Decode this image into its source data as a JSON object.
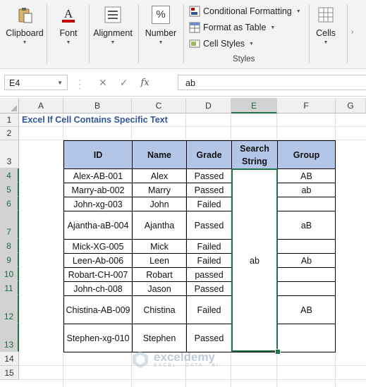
{
  "ribbon": {
    "clipboard": "Clipboard",
    "font": "Font",
    "alignment": "Alignment",
    "number": "Number",
    "number_icon": "%",
    "conditional_formatting": "Conditional Formatting",
    "format_as_table": "Format as Table",
    "cell_styles": "Cell Styles",
    "styles_group": "Styles",
    "cells": "Cells"
  },
  "formula_bar": {
    "name_box": "E4",
    "fx": "fx",
    "content": "ab"
  },
  "columns": [
    "A",
    "B",
    "C",
    "D",
    "E",
    "F",
    "G"
  ],
  "rows": [
    "1",
    "2",
    "3",
    "4",
    "5",
    "6",
    "7",
    "8",
    "9",
    "10",
    "11",
    "12",
    "13",
    "14",
    "15"
  ],
  "sheet": {
    "title": "Excel If Cell Contains Specific Text",
    "headers": [
      "ID",
      "Name",
      "Grade",
      "Search String",
      "Group"
    ],
    "search_string": "ab",
    "table": [
      {
        "id": "Alex-AB-001",
        "name": "Alex",
        "grade": "Passed",
        "group": "AB"
      },
      {
        "id": "Marry-ab-002",
        "name": "Marry",
        "grade": "Passed",
        "group": "ab"
      },
      {
        "id": "John-xg-003",
        "name": "John",
        "grade": "Failed",
        "group": ""
      },
      {
        "id": "Ajantha-aB-004",
        "name": "Ajantha",
        "grade": "Passed",
        "group": "aB"
      },
      {
        "id": "Mick-XG-005",
        "name": "Mick",
        "grade": "Failed",
        "group": ""
      },
      {
        "id": "Leen-Ab-006",
        "name": "Leen",
        "grade": "Failed",
        "group": "Ab"
      },
      {
        "id": "Robart-CH-007",
        "name": "Robart",
        "grade": "passed",
        "group": ""
      },
      {
        "id": "John-ch-008",
        "name": "Jason",
        "grade": "Passed",
        "group": ""
      },
      {
        "id": "Chistina-AB-009",
        "name": "Chistina",
        "grade": "Failed",
        "group": "AB"
      },
      {
        "id": "Stephen-xg-010",
        "name": "Stephen",
        "grade": "Passed",
        "group": ""
      }
    ]
  },
  "watermark": {
    "name": "exceldemy",
    "sub": "EXCEL · DATA · BI"
  },
  "colors": {
    "header_fill": "#b4c6e7",
    "title_color": "#2f5597",
    "selection": "#217346"
  }
}
